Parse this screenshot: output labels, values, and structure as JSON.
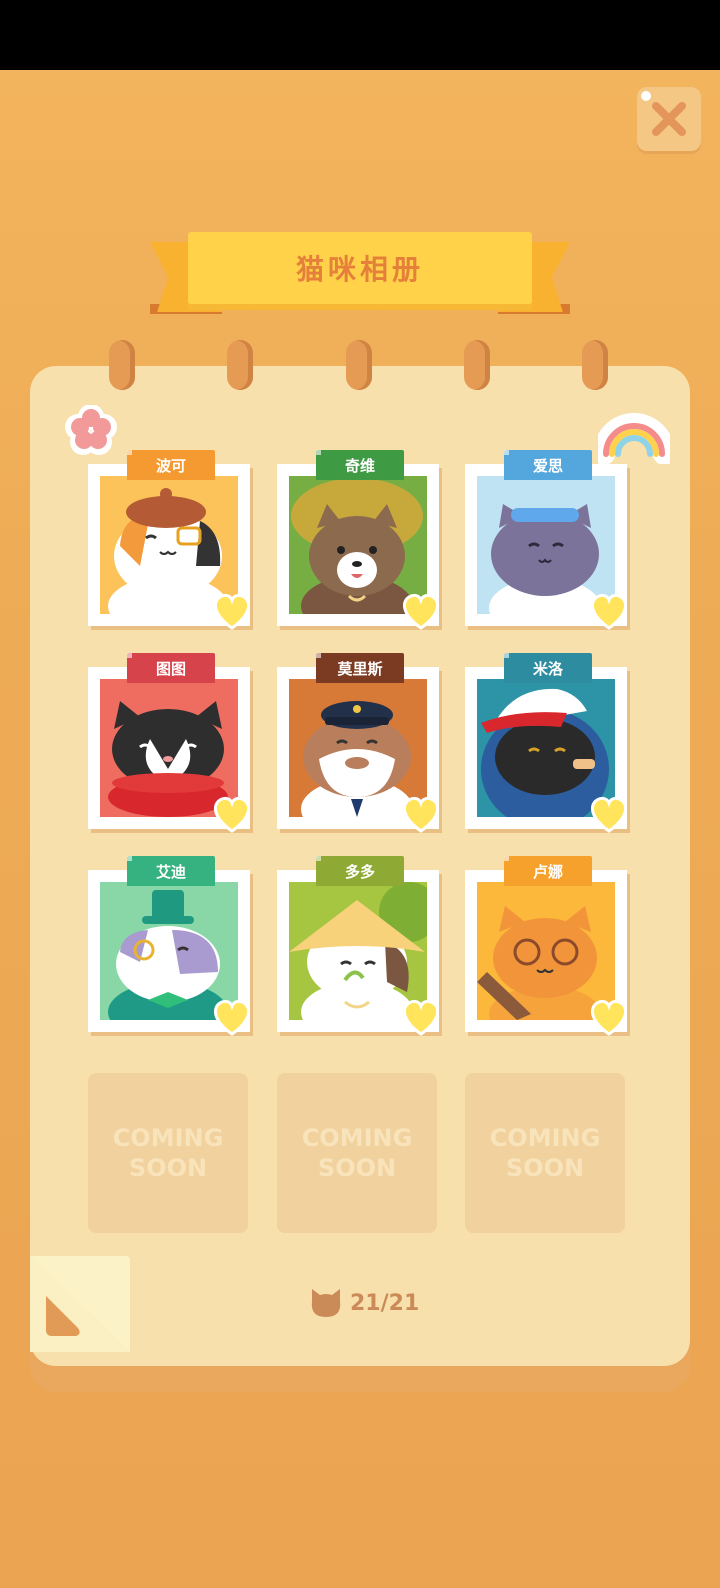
{
  "album": {
    "title": "猫咪相册",
    "close_icon": "close-icon",
    "cats": [
      {
        "name": "波可",
        "tag_color": "#F49A31",
        "bg": "#FBC35A"
      },
      {
        "name": "奇维",
        "tag_color": "#3E9A43",
        "bg": "#77AE43"
      },
      {
        "name": "爱思",
        "tag_color": "#54A7DD",
        "bg": "#BFE3F3"
      },
      {
        "name": "图图",
        "tag_color": "#D6434B",
        "bg": "#EF6D60"
      },
      {
        "name": "莫里斯",
        "tag_color": "#7B3A22",
        "bg": "#D77A38"
      },
      {
        "name": "米洛",
        "tag_color": "#2D8CA0",
        "bg": "#2D93A6"
      },
      {
        "name": "艾迪",
        "tag_color": "#35B27F",
        "bg": "#89D7A6"
      },
      {
        "name": "多多",
        "tag_color": "#8EA934",
        "bg": "#A6C541"
      },
      {
        "name": "卢娜",
        "tag_color": "#F5A12C",
        "bg": "#FBB83B"
      }
    ],
    "coming_soon": [
      {
        "line1": "COMING",
        "line2": "SOON"
      },
      {
        "line1": "COMING",
        "line2": "SOON"
      },
      {
        "line1": "COMING",
        "line2": "SOON"
      }
    ],
    "counter": "21/21"
  }
}
